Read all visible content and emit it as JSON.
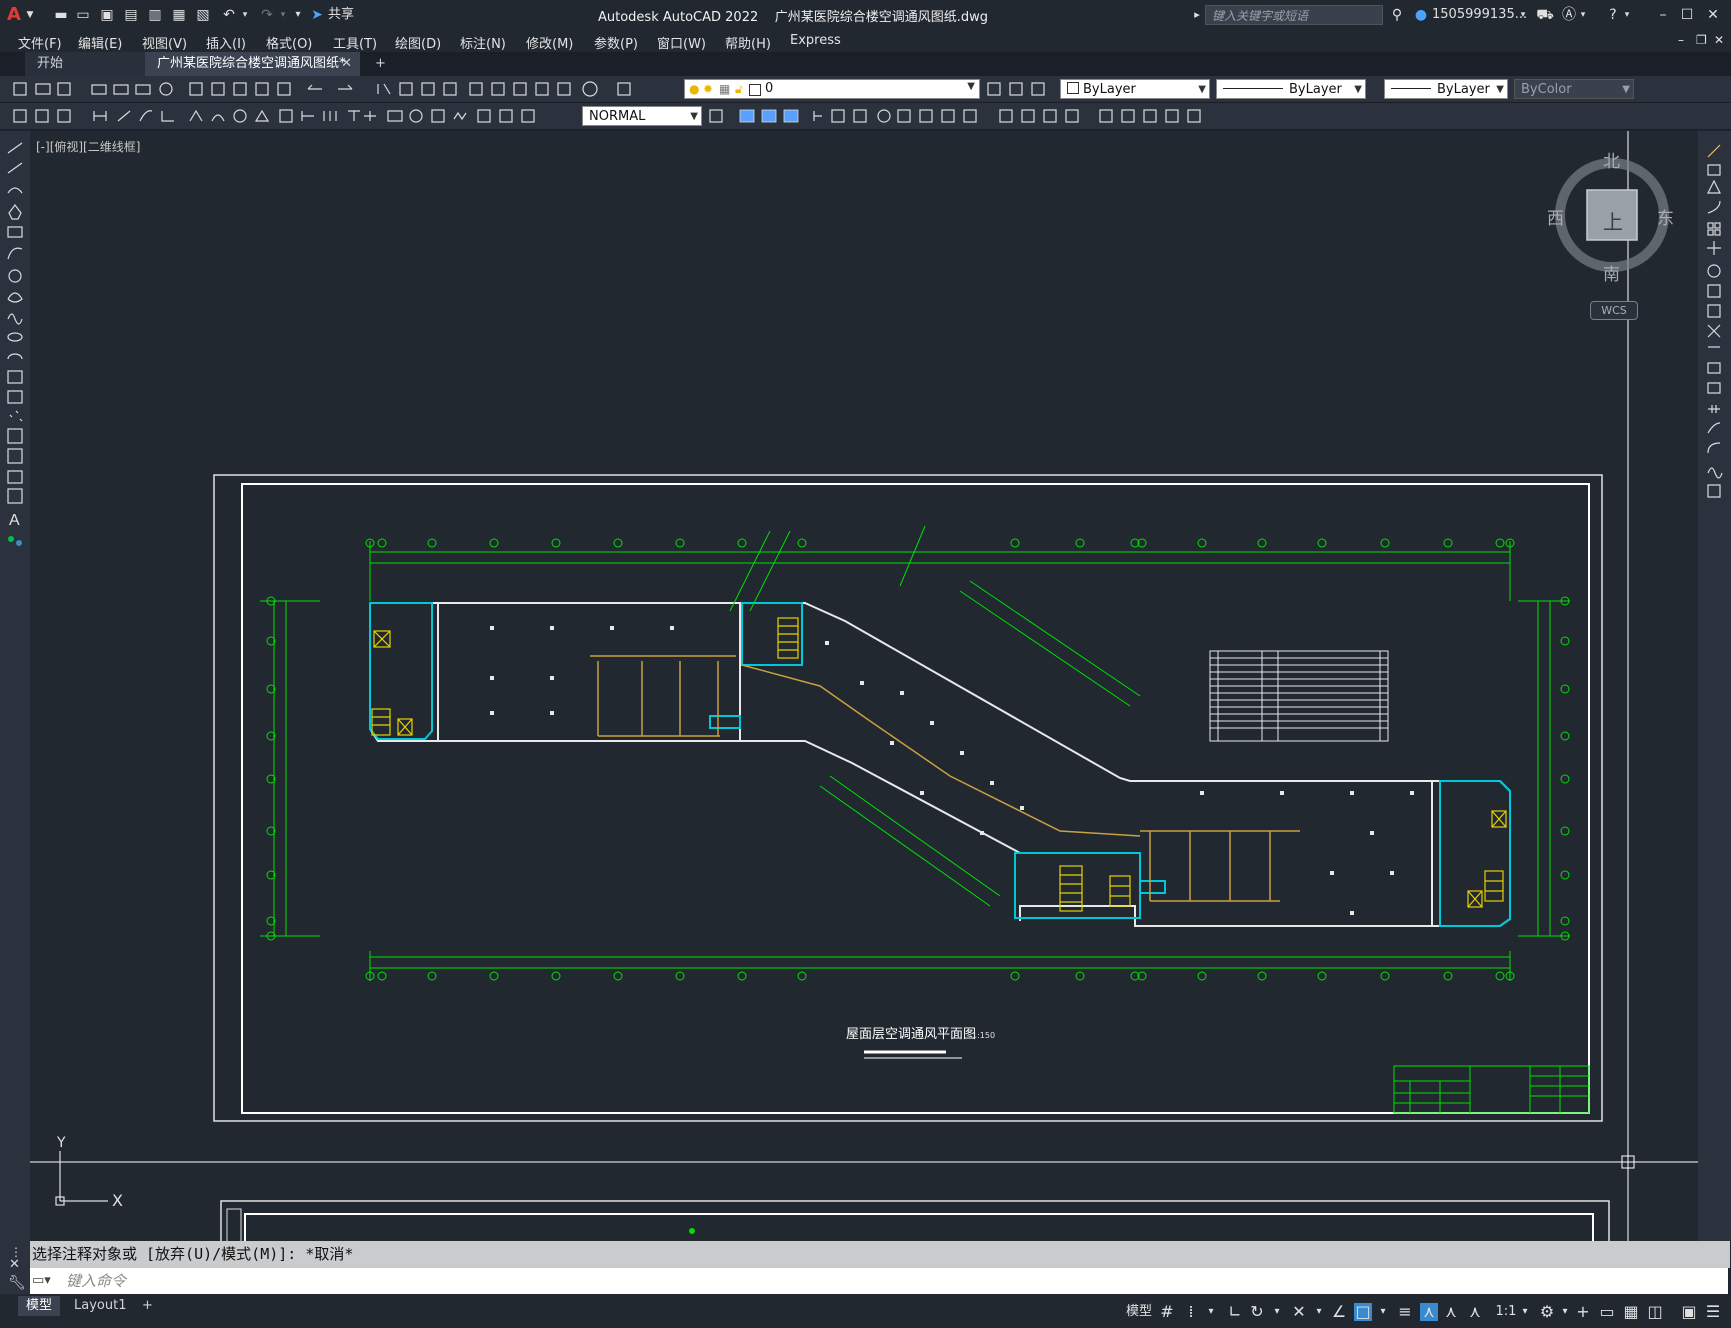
{
  "app": {
    "window_title": "Autodesk AutoCAD 2022    广州某医院综合楼空调通风图纸.dwg",
    "share_label": "共享",
    "search_placeholder": "键入关键字或短语",
    "user_label": "1505999135..."
  },
  "menubar": [
    "文件(F)",
    "编辑(E)",
    "视图(V)",
    "插入(I)",
    "格式(O)",
    "工具(T)",
    "绘图(D)",
    "标注(N)",
    "修改(M)",
    "参数(P)",
    "窗口(W)",
    "帮助(H)",
    "Express"
  ],
  "tabs": {
    "start": "开始",
    "active": "广州某医院综合楼空调通风图纸*",
    "add": "+"
  },
  "toolbar": {
    "layer_value": "0",
    "color_value": "ByLayer",
    "linetype_value": "ByLayer",
    "lineweight_value": "ByLayer",
    "plotstyle_value": "ByColor",
    "dimstyle_value": "NORMAL"
  },
  "viewport": {
    "label": "[-][俯视][二维线框]"
  },
  "navcube": {
    "north": "北",
    "south": "南",
    "east": "东",
    "west": "西",
    "face": "上",
    "wcs": "WCS"
  },
  "ucs": {
    "y": "Y",
    "x": "X"
  },
  "drawing": {
    "title": "屋面层空调通风平面图",
    "scale": "1:150"
  },
  "command": {
    "history": "选择注释对象或 [放弃(U)/模式(M)]: *取消*",
    "placeholder": "键入命令"
  },
  "status": {
    "model_tab": "模型",
    "layout_tab": "Layout1",
    "add_tab": "+",
    "model_label": "模型",
    "scale": "1:1"
  },
  "colors": {
    "background": "#212830",
    "green": "#00e000",
    "cyan": "#00c8d8",
    "yellow": "#e8d000",
    "white": "#ffffff",
    "brown": "#c8a040"
  }
}
